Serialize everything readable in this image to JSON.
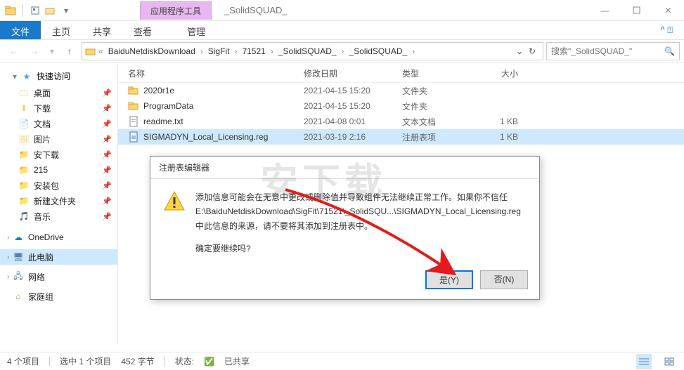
{
  "title": {
    "context_tab": "应用程序工具",
    "window": "_SolidSQUAD_"
  },
  "ribbon": {
    "file": "文件",
    "home": "主页",
    "share": "共享",
    "view": "查看",
    "manage": "管理"
  },
  "breadcrumb": {
    "segs": [
      "BaiduNetdiskDownload",
      "SigFit",
      "71521",
      "_SolidSQUAD_",
      "_SolidSQUAD_"
    ],
    "search_placeholder": "搜索\"_SolidSQUAD_\""
  },
  "nav": {
    "quick": "快速访问",
    "items": [
      {
        "label": "桌面",
        "pin": true
      },
      {
        "label": "下载",
        "pin": true
      },
      {
        "label": "文档",
        "pin": true
      },
      {
        "label": "图片",
        "pin": true
      },
      {
        "label": "安下载",
        "pin": true
      },
      {
        "label": "215",
        "pin": true
      },
      {
        "label": "安装包",
        "pin": true
      },
      {
        "label": "新建文件夹",
        "pin": true
      },
      {
        "label": "音乐",
        "pin": true
      }
    ],
    "onedrive": "OneDrive",
    "thispc": "此电脑",
    "network": "网络",
    "homegroup": "家庭组"
  },
  "columns": {
    "name": "名称",
    "date": "修改日期",
    "type": "类型",
    "size": "大小"
  },
  "rows": [
    {
      "name": "2020r1e",
      "date": "2021-04-15 15:20",
      "type": "文件夹",
      "size": "",
      "icon": "folder"
    },
    {
      "name": "ProgramData",
      "date": "2021-04-15 15:20",
      "type": "文件夹",
      "size": "",
      "icon": "folder"
    },
    {
      "name": "readme.txt",
      "date": "2021-04-08 0:01",
      "type": "文本文档",
      "size": "1 KB",
      "icon": "txt"
    },
    {
      "name": "SIGMADYN_Local_Licensing.reg",
      "date": "2021-03-19 2:16",
      "type": "注册表项",
      "size": "1 KB",
      "icon": "reg",
      "selected": true
    }
  ],
  "dialog": {
    "title": "注册表编辑器",
    "line1": "添加信息可能会在无意中更改或删除值并导致组件无法继续正常工作。如果你不信任",
    "line2": "E:\\BaiduNetdiskDownload\\SigFit\\71521\\_SolidSQU...\\SIGMADYN_Local_Licensing.reg",
    "line3": "中此信息的来源，请不要将其添加到注册表中。",
    "line4": "确定要继续吗?",
    "yes": "是(Y)",
    "no": "否(N)"
  },
  "status": {
    "count": "4 个项目",
    "selected": "选中 1 个项目",
    "bytes": "452 字节",
    "state_label": "状态:",
    "state_value": "已共享"
  },
  "watermark": "安下载"
}
